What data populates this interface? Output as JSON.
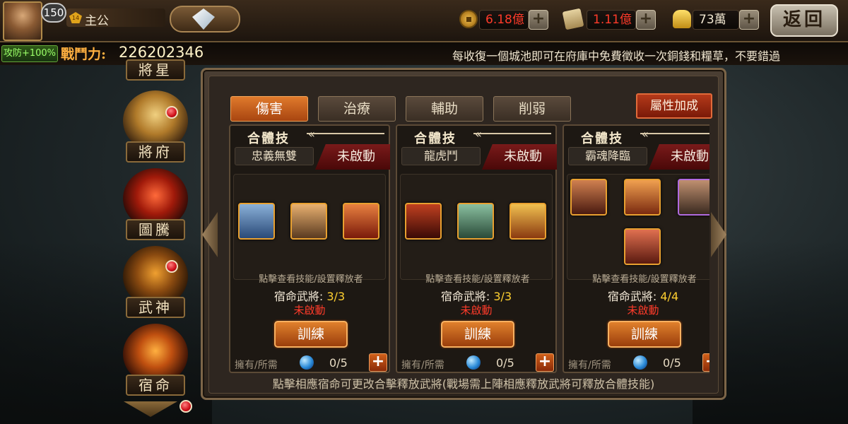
{
  "player": {
    "level": "150",
    "vip": "14",
    "name": "主公",
    "buff": "攻防+100%",
    "power_label": "戰鬥力:",
    "power_value": "226202346"
  },
  "resources": {
    "copper": "6.18億",
    "grain": "1.11億",
    "gold": "73萬",
    "copper_color": "#ff3b2a",
    "grain_color": "#ff3b2a"
  },
  "top": {
    "back_label": "返回"
  },
  "marquee": "每收復一個城池即可在府庫中免費徵收一次銅錢和糧草，不要錯過",
  "side_nav": {
    "items": [
      {
        "label": "將星",
        "icon": "star-general-icon"
      },
      {
        "label": "將府",
        "icon": "general-mansion-icon"
      },
      {
        "label": "圖騰",
        "icon": "totem-icon"
      },
      {
        "label": "武神",
        "icon": "war-god-icon"
      },
      {
        "label": "宿命",
        "icon": "destiny-icon"
      }
    ]
  },
  "tabs": [
    "傷害",
    "治療",
    "輔助",
    "削弱"
  ],
  "active_tab": 0,
  "attr_bonus": "屬性加成",
  "card_header": "合體技",
  "cards": [
    {
      "skill": "忠義無雙",
      "status": "未啟動",
      "hint": "點擊查看技能/設置釋放者",
      "fate_label": "宿命武將:",
      "fate_value": "3/3",
      "fate_status": "未啟動",
      "train": "訓練",
      "own_label": "擁有/所需",
      "own_count": "0/5",
      "heroes": [
        "hero-portrait-1",
        "hero-portrait-2",
        "hero-portrait-3"
      ]
    },
    {
      "skill": "龍虎鬥",
      "status": "未啟動",
      "hint": "點擊查看技能/設置釋放者",
      "fate_label": "宿命武將:",
      "fate_value": "3/3",
      "fate_status": "未啟動",
      "train": "訓練",
      "own_label": "擁有/所需",
      "own_count": "0/5",
      "heroes": [
        "hero-portrait-1",
        "hero-portrait-2",
        "hero-portrait-3"
      ]
    },
    {
      "skill": "霸魂降臨",
      "status": "未啟動",
      "hint": "點擊查看技能/設置釋放者",
      "fate_label": "宿命武將:",
      "fate_value": "4/4",
      "fate_status": "未啟動",
      "train": "訓練",
      "own_label": "擁有/所需",
      "own_count": "0/5",
      "heroes": [
        "hero-portrait-1",
        "hero-portrait-2",
        "hero-portrait-3",
        "hero-portrait-4"
      ]
    }
  ],
  "footer_note": "點擊相應宿命可更改合擊釋放武將(戰場需上陣相應釋放武將可釋放合體技能)"
}
